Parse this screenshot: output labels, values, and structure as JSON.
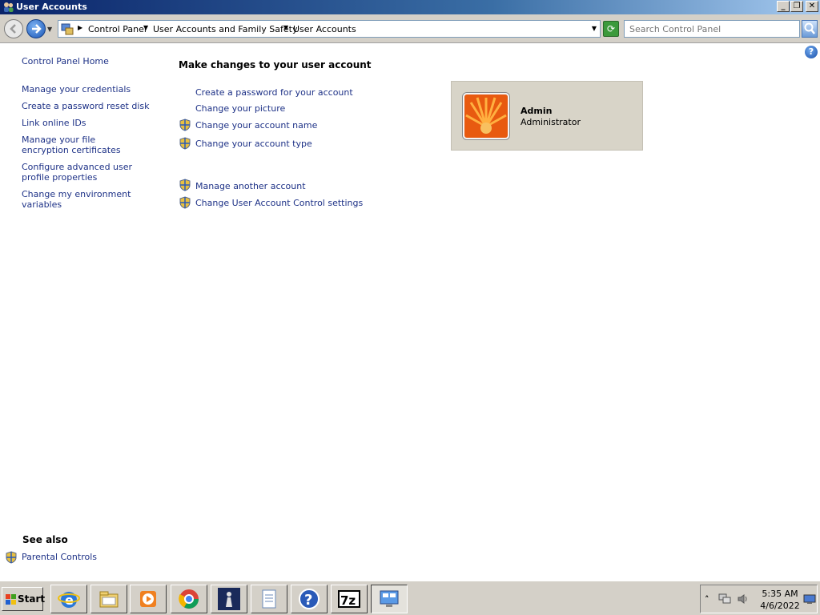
{
  "window": {
    "title": "User Accounts",
    "icons": {
      "app": "users-icon",
      "minimize": "minimize-icon",
      "restore": "restore-icon",
      "close": "close-icon"
    },
    "controls": {
      "minimize": "_",
      "restore": "❐",
      "close": "✕"
    }
  },
  "addressbar": {
    "breadcrumbs": [
      "Control Panel",
      "User Accounts and Family Safety",
      "User Accounts"
    ],
    "search_placeholder": "Search Control Panel",
    "refresh_glyph": "⟳"
  },
  "sidebar": {
    "home": "Control Panel Home",
    "links": [
      "Manage your credentials",
      "Create a password reset disk",
      "Link online IDs",
      "Manage your file encryption certificates",
      "Configure advanced user profile properties",
      "Change my environment variables"
    ],
    "see_also_heading": "See also",
    "see_also_links": [
      "Parental Controls"
    ]
  },
  "main": {
    "heading": "Make changes to your user account",
    "tasks": [
      {
        "label": "Create a password for your account",
        "shield": false
      },
      {
        "label": "Change your picture",
        "shield": false
      },
      {
        "label": "Change your account name",
        "shield": true
      },
      {
        "label": "Change your account type",
        "shield": true
      }
    ],
    "other_tasks": [
      {
        "label": "Manage another account",
        "shield": true
      },
      {
        "label": "Change User Account Control settings",
        "shield": true
      }
    ],
    "help_glyph": "?"
  },
  "account": {
    "name": "Admin",
    "type": "Administrator",
    "picture": "orange-flower-picture"
  },
  "taskbar": {
    "start_label": "Start",
    "apps": [
      "internet-explorer-icon",
      "file-explorer-icon",
      "media-player-icon",
      "chrome-icon",
      "chess-icon",
      "document-icon",
      "help-icon",
      "7zip-icon",
      "control-panel-icon"
    ],
    "seven_zip_label": "7z",
    "help_glyph": "?",
    "tray": {
      "expand_glyph": "˄",
      "time": "5:35 AM",
      "date": "4/6/2022"
    }
  },
  "colors": {
    "link": "#1e3287",
    "card": "#d8d4c8",
    "chrome": "#d4d0c8"
  }
}
